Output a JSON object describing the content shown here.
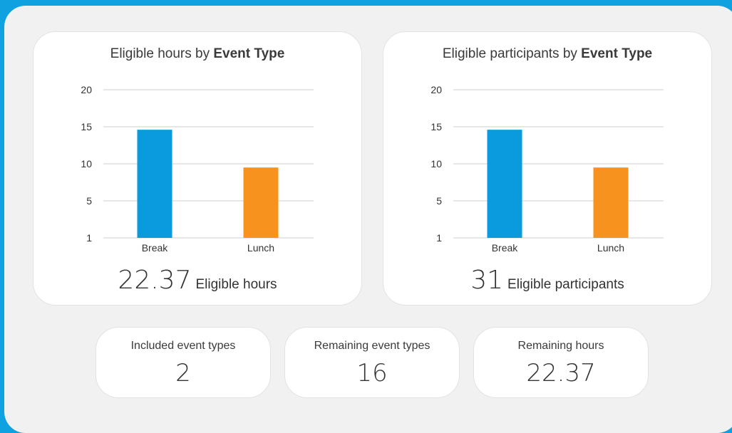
{
  "chart_data": [
    {
      "type": "bar",
      "title_prefix": "Eligible hours by",
      "title_emphasis": "Event Type",
      "categories": [
        "Break",
        "Lunch"
      ],
      "values": [
        14.6,
        9.5
      ],
      "colors": [
        "#0a9ade",
        "#f7921e"
      ],
      "yticks": [
        1,
        5,
        10,
        15,
        20
      ],
      "ylim": [
        1,
        20
      ],
      "grid": true,
      "summary_value": "22.37",
      "summary_label": "Eligible hours"
    },
    {
      "type": "bar",
      "title_prefix": "Eligible participants by",
      "title_emphasis": "Event Type",
      "categories": [
        "Break",
        "Lunch"
      ],
      "values": [
        14.6,
        9.5
      ],
      "colors": [
        "#0a9ade",
        "#f7921e"
      ],
      "yticks": [
        1,
        5,
        10,
        15,
        20
      ],
      "ylim": [
        1,
        20
      ],
      "grid": true,
      "summary_value": "31",
      "summary_label": "Eligible participants"
    }
  ],
  "stats": [
    {
      "label": "Included event types",
      "value": "2"
    },
    {
      "label": "Remaining event types",
      "value": "16"
    },
    {
      "label": "Remaining hours",
      "value": "22.37"
    }
  ]
}
